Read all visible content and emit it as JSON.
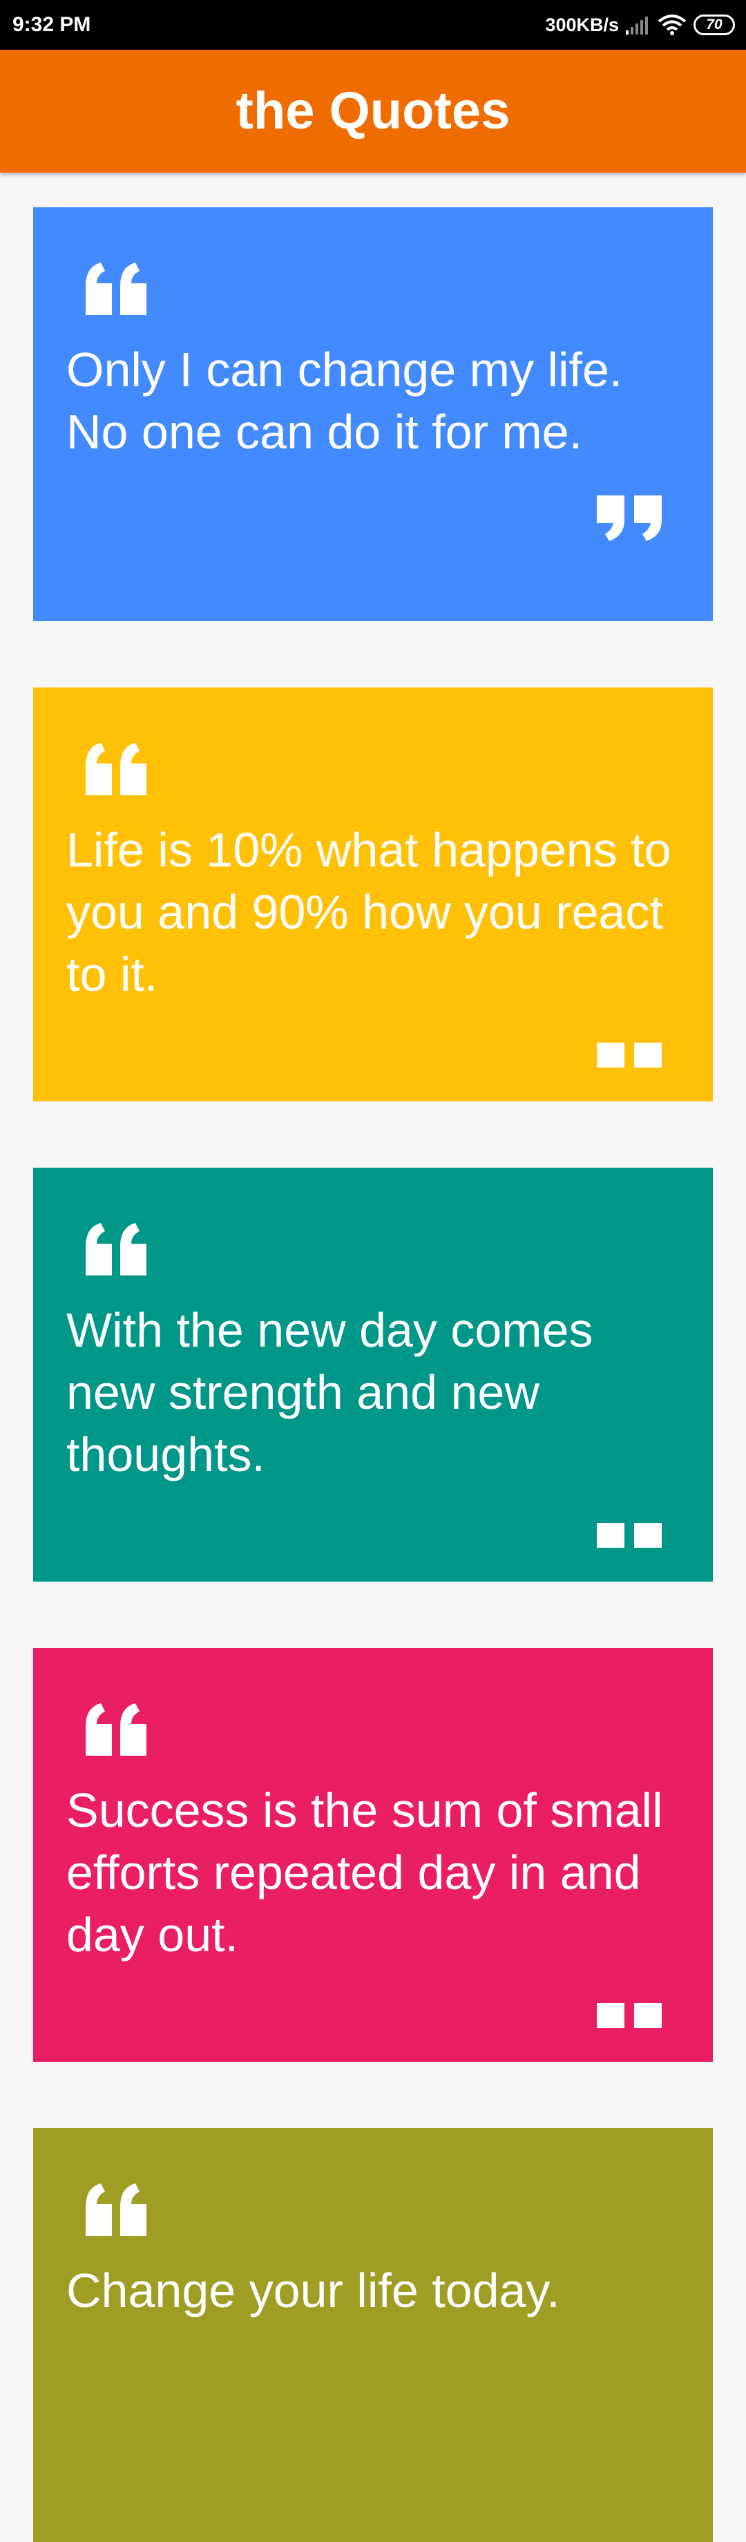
{
  "status_bar": {
    "time": "9:32 PM",
    "network_speed": "300KB/s",
    "battery_level": "70",
    "icons": [
      "signal-icon",
      "wifi-icon",
      "battery-icon"
    ]
  },
  "app_bar": {
    "title": "the Quotes",
    "color": "#ef6c00"
  },
  "quotes": [
    {
      "text": "Only I can change my life. No one can do it for me.",
      "color": "#448aff",
      "closing_mark": "close-quote-icon"
    },
    {
      "text": "Life is 10% what happens to you and 90% how you react to it.",
      "color": "#ffc107",
      "closing_mark": "square-marks-icon"
    },
    {
      "text": "With the new day comes new strength and new thoughts.",
      "color": "#009688",
      "closing_mark": "square-marks-icon"
    },
    {
      "text": "Success is the sum of small efforts repeated day in and day out.",
      "color": "#e91e63",
      "closing_mark": "square-marks-icon"
    },
    {
      "text": "Change your life today.",
      "color": "#9e9d24",
      "closing_mark": "none"
    }
  ]
}
